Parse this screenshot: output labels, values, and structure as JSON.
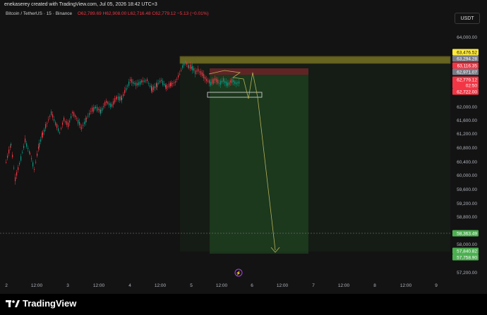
{
  "header": {
    "attribution": "enekaserey created with TradingView.com, Jul 05, 2026 18:42 UTC+3"
  },
  "legend": {
    "symbol": "Bitcoin / TetherUS · 15 · Binance",
    "open": "O62,789.69",
    "high": "H62,908.00",
    "low": "L62,716.48",
    "close": "C62,779.12",
    "change": "−5.13 (−0.01%)"
  },
  "currency_button": "USDT",
  "price_axis": {
    "ticks": [
      "64,000.00",
      "62,000.00",
      "61,600.00",
      "61,200.00",
      "60,800.00",
      "60,400.00",
      "60,000.00",
      "59,600.00",
      "59,200.00",
      "58,800.00",
      "58,000.00",
      "57,200.00"
    ],
    "badges": [
      {
        "label": "63,476.52",
        "bg": "#ffeb3b",
        "fg": "#131313"
      },
      {
        "label": "63,294.28",
        "bg": "#787b86",
        "fg": "#ffffff"
      },
      {
        "label": "63,116.35",
        "bg": "#f23645",
        "fg": "#ffffff"
      },
      {
        "label": "62,971.07",
        "bg": "#787b86",
        "fg": "#ffffff"
      },
      {
        "label": "62,779.12",
        "bg": "#f23645",
        "fg": "#ffffff"
      },
      {
        "label": "02:50",
        "bg": "#f23645",
        "fg": "#ffffff"
      },
      {
        "label": "62,722.00",
        "bg": "#f23645",
        "fg": "#ffffff"
      },
      {
        "label": "58,363.49",
        "bg": "#4caf50",
        "fg": "#ffffff"
      },
      {
        "label": "57,840.82",
        "bg": "#4caf50",
        "fg": "#ffffff"
      },
      {
        "label": "57,758.90",
        "bg": "#4caf50",
        "fg": "#ffffff"
      }
    ]
  },
  "time_axis": {
    "ticks": [
      "2",
      "12:00",
      "3",
      "12:00",
      "4",
      "12:00",
      "5",
      "12:00",
      "6",
      "12:00",
      "7",
      "12:00",
      "8",
      "12:00",
      "9"
    ]
  },
  "series": {
    "up_color": "#089981",
    "down_color": "#f23645"
  },
  "footer": {
    "brand": "TradingView"
  }
}
